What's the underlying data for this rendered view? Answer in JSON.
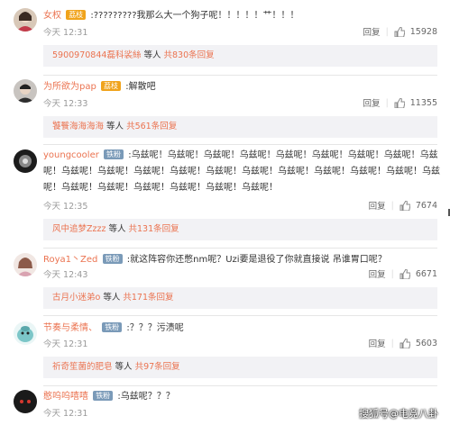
{
  "comments": [
    {
      "name": "女权",
      "badge": "荔枝",
      "text": ":?????????我那么大一个狗子呢！！！！！艹！！！",
      "time": "今天 12:31",
      "reply_label": "回复",
      "likes": "15928",
      "reply_summary": {
        "who": "5900970844磊科裟絲",
        "wait": " 等人 ",
        "total": "共830条回复"
      }
    },
    {
      "name": "为所欲为pap",
      "badge": "荔枝",
      "text": ":解散吧",
      "time": "今天 12:33",
      "reply_label": "回复",
      "likes": "11355",
      "reply_summary": {
        "who": "饕餮海海海海",
        "wait": " 等人 ",
        "total": "共561条回复"
      }
    },
    {
      "name": "youngcooler",
      "badge": "铁粉",
      "text": ":乌兹呢！乌兹呢！乌兹呢！乌兹呢！乌兹呢！乌兹呢！乌兹呢！乌兹呢！乌兹呢！乌兹呢！乌兹呢！乌兹呢！乌兹呢！乌兹呢！乌兹呢！乌兹呢！乌兹呢！乌兹呢！乌兹呢！乌兹呢！乌兹呢！乌兹呢！乌兹呢！乌兹呢！乌兹呢！乌兹呢！",
      "time": "今天 12:35",
      "reply_label": "回复",
      "likes": "7674",
      "reply_summary": {
        "who": "风中追梦Zzzz",
        "wait": " 等人 ",
        "total": "共131条回复"
      }
    },
    {
      "name": "Roya1丶Zed",
      "badge": "铁粉",
      "text": ":就这阵容你还憋nm呢？Uzi要是退役了你就直接说 吊谁胃口呢？",
      "time": "今天 12:43",
      "reply_label": "回复",
      "likes": "6671",
      "reply_summary": {
        "who": "古月小迷弟o",
        "wait": " 等人 ",
        "total": "共171条回复"
      }
    },
    {
      "name": "节奏与柔情、",
      "badge": "铁粉",
      "text": ":？？？污渍呢",
      "time": "今天 12:31",
      "reply_label": "回复",
      "likes": "5603",
      "reply_summary": {
        "who": "祈奇笙菌的肥皂",
        "wait": " 等人 ",
        "total": "共97条回复"
      }
    },
    {
      "name": "憨呜呜嘻嘻",
      "badge": "铁粉",
      "text": ":乌兹呢？？？",
      "time": "今天 12:31",
      "reply_label": "回复",
      "likes": ""
    }
  ],
  "watermark": "搜狐号@电竞八卦",
  "colors": {
    "name": "#eb7350",
    "meta": "#999999",
    "reply_bg": "#f2f2f5"
  }
}
